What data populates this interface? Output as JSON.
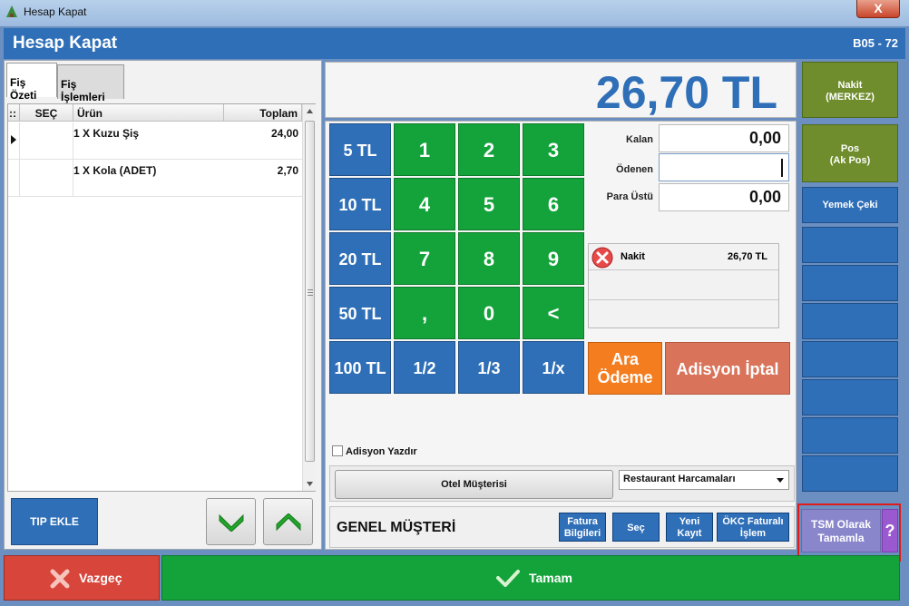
{
  "window": {
    "title": "Hesap Kapat",
    "close_label": "X"
  },
  "header": {
    "title": "Hesap Kapat",
    "code": "B05 - 72"
  },
  "tabs": [
    {
      "label": "Fiş Özeti"
    },
    {
      "label": "Fiş İşlemleri"
    }
  ],
  "table": {
    "headers": {
      "handle": "::",
      "sec": "SEÇ",
      "urun": "Ürün",
      "toplam": "Toplam"
    },
    "rows": [
      {
        "urun": "1 X Kuzu Şiş",
        "toplam": "24,00"
      },
      {
        "urun": "1 X Kola (ADET)",
        "toplam": "2,70"
      }
    ]
  },
  "left_buttons": {
    "tip_ekle": "TIP EKLE"
  },
  "amount": "26,70 TL",
  "keypad": {
    "money": [
      "5 TL",
      "10 TL",
      "20 TL",
      "50 TL",
      "100 TL"
    ],
    "digits": [
      "1",
      "2",
      "3",
      "4",
      "5",
      "6",
      "7",
      "8",
      "9",
      ",",
      "0",
      "<"
    ],
    "fractions": [
      "1/2",
      "1/3",
      "1/x"
    ]
  },
  "fields": {
    "kalan_label": "Kalan",
    "kalan_value": "0,00",
    "odenen_label": "Ödenen",
    "odenen_value": "",
    "para_ustu_label": "Para Üstü",
    "para_ustu_value": "0,00"
  },
  "payments": [
    {
      "type": "Nakit",
      "amount": "26,70 TL"
    }
  ],
  "actions": {
    "ara_odeme_line1": "Ara",
    "ara_odeme_line2": "Ödeme",
    "adisyon_iptal": "Adisyon İptal"
  },
  "adisyon_yazdir": "Adisyon Yazdır",
  "otel_musterisi": "Otel Müşterisi",
  "harcama_select": "Restaurant Harcamaları",
  "customer": {
    "name": "GENEL MÜŞTERİ",
    "fatura_line1": "Fatura",
    "fatura_line2": "Bilgileri",
    "sec": "Seç",
    "yeni_line1": "Yeni",
    "yeni_line2": "Kayıt",
    "okc_line1": "ÖKC Faturalı",
    "okc_line2": "İşlem"
  },
  "right_panel": {
    "nakit_line1": "Nakit",
    "nakit_line2": "(MERKEZ)",
    "pos_line1": "Pos",
    "pos_line2": "(Ak Pos)",
    "yemek_ceki": "Yemek Çeki",
    "tsm_line1": "TSM Olarak",
    "tsm_line2": "Tamamla",
    "help": "?"
  },
  "footer": {
    "vazgec": "Vazgeç",
    "tamam": "Tamam"
  },
  "colors": {
    "blue": "#2f6fb8",
    "green": "#14a33a",
    "orange": "#f47d20",
    "salmon": "#d9735a",
    "olive": "#6f8d2c",
    "red": "#d8453a",
    "highlight": "#e11b1b",
    "purple": "#9b7fd0"
  }
}
